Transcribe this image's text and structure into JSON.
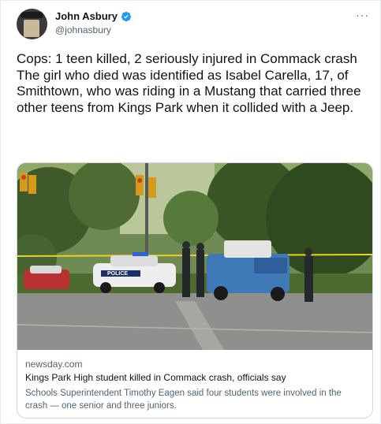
{
  "tweet": {
    "author": {
      "display_name": "John Asbury",
      "handle": "@johnasbury",
      "verified": true,
      "avatar": "profile-photo"
    },
    "more_label": "···",
    "paragraph1": "Cops: 1 teen killed, 2 seriously injured in Commack crash",
    "paragraph2": "The girl who died was identified as Isabel Carella, 17, of Smithtown, who was riding in a Mustang that carried three other teens from Kings Park when it collided with a Jeep."
  },
  "card": {
    "image": "crash-scene-photo",
    "police_car_label": "POLICE",
    "domain": "newsday.com",
    "title": "Kings Park High student killed in Commack crash, officials say",
    "description": "Schools Superintendent Timothy Eagen said four students were involved in the crash — one senior and three juniors."
  },
  "colors": {
    "verified_badge": "#1d9bf0",
    "secondary_text": "#536471",
    "primary_text": "#0f1419",
    "card_border": "#cfd9de"
  }
}
